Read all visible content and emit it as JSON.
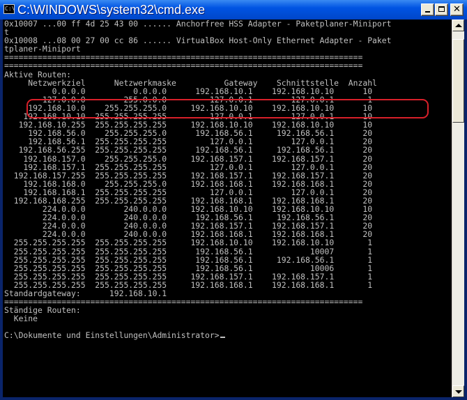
{
  "window": {
    "title": "C:\\WINDOWS\\system32\\cmd.exe",
    "icon": "cmd-icon",
    "icon_text": "C:\\"
  },
  "console": {
    "lines": [
      "0x10007 ...00 ff 4d 25 43 00 ...... Anchorfree HSS Adapter - Paketplaner-Miniport",
      "t",
      "0x10008 ...08 00 27 00 cc 86 ...... VirtualBox Host-Only Ethernet Adapter - Paket",
      "tplaner-Miniport",
      "===========================================================================",
      "===========================================================================",
      "Aktive Routen:",
      "     Netzwerkziel      Netzwerkmaske          Gateway    Schnittstelle  Anzahl",
      "          0.0.0.0          0.0.0.0      192.168.10.1    192.168.10.10      10",
      "        127.0.0.0        255.0.0.0         127.0.0.1        127.0.0.1       1",
      "     192.168.10.0    255.255.255.0     192.168.10.10    192.168.10.10      10",
      "    192.168.10.10  255.255.255.255         127.0.0.1        127.0.0.1      10",
      "   192.168.10.255  255.255.255.255     192.168.10.10    192.168.10.10      10",
      "     192.168.56.0    255.255.255.0      192.168.56.1     192.168.56.1      20",
      "     192.168.56.1  255.255.255.255         127.0.0.1        127.0.0.1      20",
      "   192.168.56.255  255.255.255.255      192.168.56.1     192.168.56.1      20",
      "    192.168.157.0    255.255.255.0     192.168.157.1    192.168.157.1      20",
      "    192.168.157.1  255.255.255.255         127.0.0.1        127.0.0.1      20",
      "  192.168.157.255  255.255.255.255     192.168.157.1    192.168.157.1      20",
      "    192.168.168.0    255.255.255.0     192.168.168.1    192.168.168.1      20",
      "    192.168.168.1  255.255.255.255         127.0.0.1        127.0.0.1      20",
      "  192.168.168.255  255.255.255.255     192.168.168.1    192.168.168.1      20",
      "        224.0.0.0        240.0.0.0     192.168.10.10    192.168.10.10      10",
      "        224.0.0.0        240.0.0.0      192.168.56.1     192.168.56.1      20",
      "        224.0.0.0        240.0.0.0     192.168.157.1    192.168.157.1      20",
      "        224.0.0.0        240.0.0.0     192.168.168.1    192.168.168.1      20",
      "  255.255.255.255  255.255.255.255     192.168.10.10    192.168.10.10       1",
      "  255.255.255.255  255.255.255.255      192.168.56.1            10007       1",
      "  255.255.255.255  255.255.255.255      192.168.56.1     192.168.56.1       1",
      "  255.255.255.255  255.255.255.255      192.168.56.1            10006       1",
      "  255.255.255.255  255.255.255.255     192.168.157.1    192.168.157.1       1",
      "  255.255.255.255  255.255.255.255     192.168.168.1    192.168.168.1       1",
      "Standardgateway:      192.168.10.1",
      "===========================================================================",
      "Ständige Routen:",
      "  Keine",
      "",
      "C:\\Dokumente und Einstellungen\\Administrator>"
    ]
  },
  "annotation": {
    "color": "#d8202a"
  },
  "colors": {
    "console_bg": "#000000",
    "console_fg": "#c0c0c0",
    "titlebar": "#0054e3"
  }
}
